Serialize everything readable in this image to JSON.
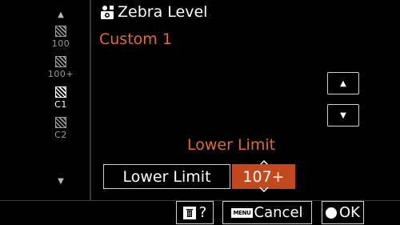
{
  "header": {
    "title": "Zebra Level",
    "title_icon": "camera-settings-icon",
    "subtitle": "Custom 1"
  },
  "sidebar": {
    "up_arrow": "▲",
    "down_arrow": "▼",
    "items": [
      {
        "label": "100",
        "icon": "zebra-pattern-icon",
        "active": false
      },
      {
        "label": "100+",
        "icon": "zebra-pattern-icon",
        "active": false
      },
      {
        "label": "C1",
        "icon": "zebra-pattern-icon",
        "active": true
      },
      {
        "label": "C2",
        "icon": "zebra-pattern-icon",
        "active": false
      }
    ]
  },
  "nav_buttons": {
    "up": "▲",
    "down": "▼"
  },
  "editor": {
    "heading": "Lower Limit",
    "parameter_label": "Lower Limit",
    "value": "107+"
  },
  "footer": {
    "help_label": "?",
    "menu_key": "MENU",
    "cancel_label": "Cancel",
    "ok_label": "OK"
  },
  "colors": {
    "accent": "#e06a2a",
    "selected_value_bg": "#c4481d",
    "background": "#000000"
  }
}
